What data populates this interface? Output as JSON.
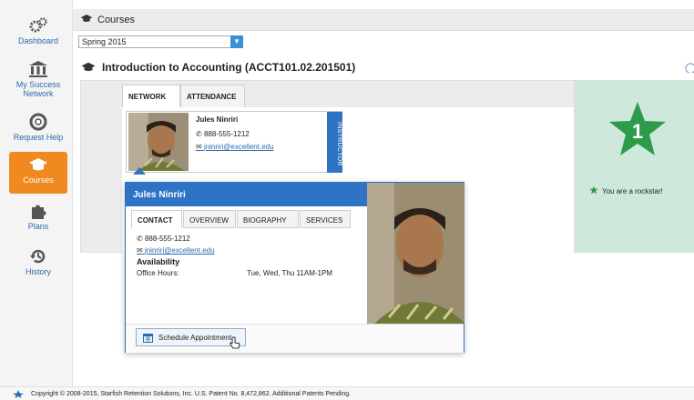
{
  "sidebar": {
    "items": [
      {
        "label": "Dashboard",
        "icon": "gears-icon"
      },
      {
        "label": "My Success Network",
        "icon": "bank-icon"
      },
      {
        "label": "Request Help",
        "icon": "lifebuoy-icon"
      },
      {
        "label": "Courses",
        "icon": "graduation-cap-icon"
      },
      {
        "label": "Plans",
        "icon": "puzzle-icon"
      },
      {
        "label": "History",
        "icon": "history-icon"
      }
    ],
    "active": "Courses",
    "active_color": "#f0891f"
  },
  "header": {
    "title": "Courses"
  },
  "term_select": {
    "value": "Spring 2015"
  },
  "course": {
    "title": "Introduction to Accounting (ACCT101.02.201501)"
  },
  "tabs": [
    {
      "label": "NETWORK",
      "selected": true
    },
    {
      "label": "ATTENDANCE",
      "selected": false
    }
  ],
  "instructor_card": {
    "name": "Jules Ninriri",
    "phone": "888-555-1212",
    "email": "jninriri@excellent.edu",
    "role": "INSTRUCTOR"
  },
  "achievement": {
    "number": "1",
    "text": "You are a rockstar!",
    "color": "#2e9b4a"
  },
  "popup": {
    "name": "Jules Ninriri",
    "tabs": [
      {
        "label": "CONTACT",
        "selected": true
      },
      {
        "label": "OVERVIEW",
        "selected": false
      },
      {
        "label": "BIOGRAPHY",
        "selected": false
      },
      {
        "label": "SERVICES",
        "selected": false
      }
    ],
    "phone": "888-555-1212",
    "email": "jninriri@excellent.edu",
    "availability_heading": "Availability",
    "office_hours_label": "Office Hours:",
    "office_hours_value": "Tue, Wed, Thu 11AM-1PM",
    "schedule_button": "Schedule Appointment"
  },
  "footer": {
    "text": "Copyright © 2008-2015, Starfish Retention Solutions, Inc. U.S. Patent No. 8,472,862. Additional Patents Pending."
  },
  "colors": {
    "brand_blue": "#2f73c4",
    "link": "#2a6ab0"
  }
}
